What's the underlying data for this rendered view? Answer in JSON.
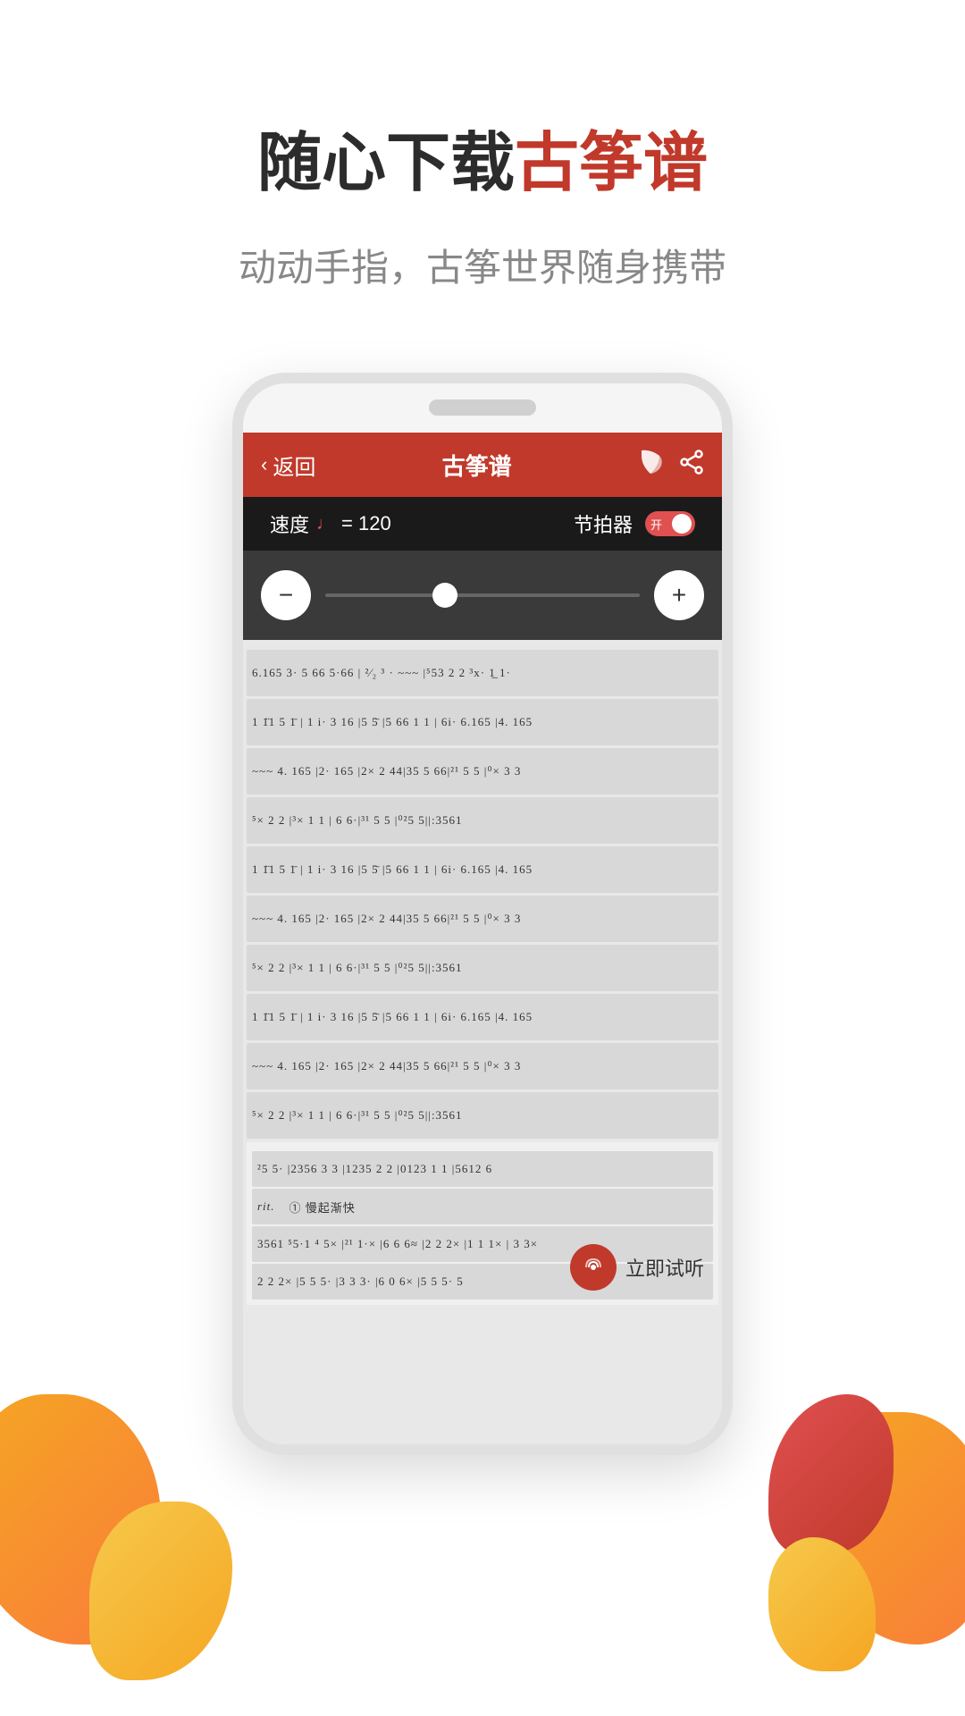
{
  "page": {
    "background_color": "#ffffff"
  },
  "header": {
    "main_title_part1": "随心下载",
    "main_title_part2": "古筝谱",
    "sub_title": "动动手指，古筝世界随身携带"
  },
  "app": {
    "header": {
      "back_label": "返回",
      "title": "古筝谱",
      "bookmark_icon": "bookmark-icon",
      "share_icon": "share-icon"
    },
    "speed_bar": {
      "speed_label": "速度",
      "note_symbol": "♩",
      "speed_value": "= 120",
      "metronome_label": "节拍器",
      "toggle_on_label": "开",
      "toggle_state": "on"
    },
    "slider": {
      "minus_label": "−",
      "plus_label": "+"
    },
    "music_lines": [
      "6.165 3·   5 66 5 66  |  ²⁄₂  ³  ·  ~~~  | ⁵53 2 2 ³x·  1̲ 1·",
      "1 1̈1  5 1̄  | 1 i·  3 16 |5    5̄   |5 66 1 1  | 6i·  6.165 |4.    165",
      "~~~        4.    165  |2·   165  |2×  2 44|35  5  66|²¹  5 5  |⁰× 3 3",
      "⁵×   2 2  |³×  1 1  |       6  6·|³¹  5 5  |⁰²5  5||:3561",
      "1 1̈1  5 1̄  | 1 i·  3 16 |5    5̄   |5 66 1 1  | 6i·  6.165 |4.    165",
      "~~~        4.    165  |2·   165  |2×  2 44|35  5  66|²¹  5 5  |⁰× 3 3",
      "⁵×   2 2  |³×  1 1  |       6  6·|³¹  5 5  |⁰²5  5||:3561"
    ],
    "bottom_music_lines": [
      "²5 5·  |2356  3 3  |1235  2 2  |0123   1 1  |5612  6",
      "rit.  ²        ①慢起渐快",
      "3561 ⁵5·1̲  ⁴  5×  |²¹  1·×  |6 6  6=  |2 2 2×  |1 1  1×  | 3 3×",
      "2 2  2×  |5 5  5·  |3 3  3·  |6 0  6×  |5 5  5·  5"
    ],
    "trial_listen": {
      "audio_icon": "audio-wave-icon",
      "label": "立即试听"
    }
  }
}
